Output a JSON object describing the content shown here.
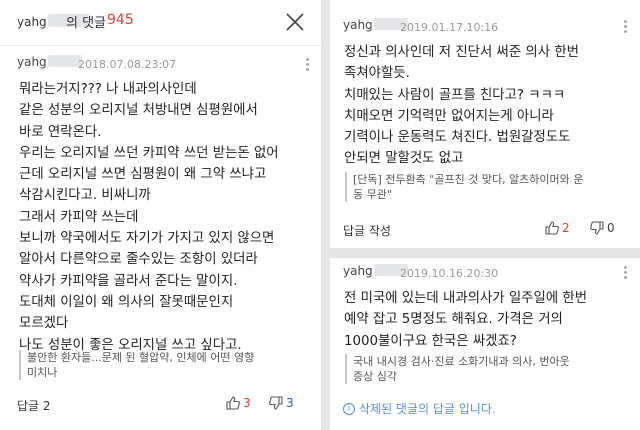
{
  "left": {
    "header": {
      "user_prefix": "yahg",
      "title": "의 댓글",
      "count": "945"
    },
    "comment": {
      "user_prefix": "yahg",
      "timestamp": "2018.07.08.23:07",
      "lines": [
        "뭐라는거지??? 나 내과의사인데",
        "같은 성분의 오리지널 처방내면 심평원에서",
        "바로 연락온다.",
        "우리는 오리지널 쓰던 카피약 쓰던 받는돈 없어",
        "근데 오리지널 쓰면 심평원이 왜 그약 쓰냐고",
        "삭감시킨다고. 비싸니까",
        "그래서 카피약 쓰는데",
        "보니까 약국에서도 자기가 가지고 있지 않으면",
        "알아서 다른약으로 줄수있는 조항이 있더라",
        "약사가 카피약을 골라서 준다는 말이지.",
        "도대체 이일이 왜 의사의 잘못때문인지",
        "모르겠다",
        "나도 성분이 좋은 오리지널 쓰고 싶다고."
      ],
      "quote_lines": [
        "불안한 환자들...문제 된 혈압약, 인체에 어떤 영향",
        "미치나"
      ],
      "reply_label": "답글 2",
      "likes": "3",
      "dislikes": "3"
    }
  },
  "right_top": {
    "user_prefix": "yahg",
    "timestamp": "2019.01.17.10:16",
    "lines": [
      "정신과 의사인데 저 진단서 써준 의사 한번",
      "족쳐야할듯.",
      "치매있는 사람이 골프를 친다고? ㅋㅋㅋ",
      "치매오면 기억력만 없어지는게 아니라",
      "기력이나 운동력도 쳐진다. 법원갈정도도",
      "안되면 말할것도 없고"
    ],
    "quote_lines": [
      "[단독] 전두환측 \"골프친 것 맞다, 알츠하이머와 운",
      "동 무관\""
    ],
    "reply_label": "답글 작성",
    "likes": "2",
    "dislikes": "0"
  },
  "right_bottom": {
    "user_prefix": "yahg",
    "timestamp": "2019.10.16.20:30",
    "lines": [
      "전 미국에 있는데 내과의사가 일주일에 한번",
      "예약 잡고 5명정도 해줘요. 가격은 거의",
      "1000불이구요 한국은 싸겠죠?"
    ],
    "quote_lines": [
      "국내 내시경 검사·진료 소화기내과 의사, 번아웃",
      "증상 심각"
    ],
    "notice": "삭제된 댓글의 답글 입니다."
  },
  "colors": {
    "accent_red": "#e53935",
    "accent_blue": "#1e64c8",
    "notice_blue": "#5a8ed8"
  }
}
